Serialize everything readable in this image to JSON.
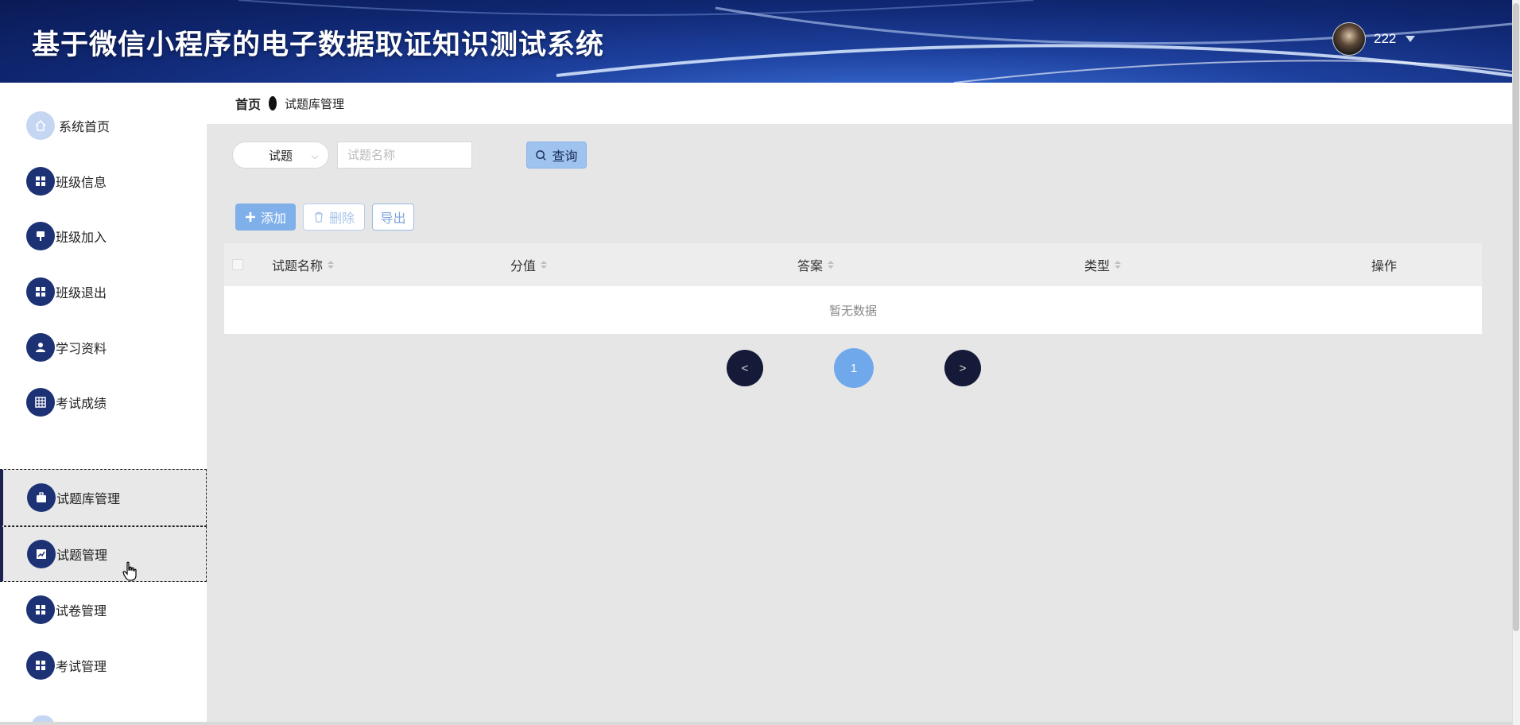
{
  "header": {
    "title": "基于微信小程序的电子数据取证知识测试系统",
    "username": "222"
  },
  "breadcrumb": {
    "home": "首页",
    "current": "试题库管理"
  },
  "sidebar": {
    "items": [
      {
        "label": "系统首页",
        "icon": "home-icon"
      },
      {
        "label": "班级信息",
        "icon": "grid-icon"
      },
      {
        "label": "班级加入",
        "icon": "pin-icon"
      },
      {
        "label": "班级退出",
        "icon": "grid-icon"
      },
      {
        "label": "学习资料",
        "icon": "user-icon"
      },
      {
        "label": "考试成绩",
        "icon": "table-icon"
      },
      {
        "label": "试题库管理",
        "icon": "briefcase-icon"
      },
      {
        "label": "试题管理",
        "icon": "chart-icon"
      },
      {
        "label": "试卷管理",
        "icon": "grid-icon"
      },
      {
        "label": "考试管理",
        "icon": "grid-icon"
      }
    ]
  },
  "search": {
    "select_value": "试题",
    "input_placeholder": "试题名称",
    "query_label": "查询"
  },
  "toolbar": {
    "add_label": "添加",
    "delete_label": "删除",
    "export_label": "导出"
  },
  "table": {
    "columns": [
      "试题名称",
      "分值",
      "答案",
      "类型",
      "操作"
    ],
    "empty_text": "暂无数据"
  },
  "pagination": {
    "prev": "<",
    "current": "1",
    "next": ">"
  },
  "colors": {
    "header_bg": "#0f2670",
    "sidebar_icon": "#1c3275",
    "primary_button": "#7fb0ea",
    "active_page": "#6fa9ec",
    "main_bg": "#e6e6e6"
  }
}
